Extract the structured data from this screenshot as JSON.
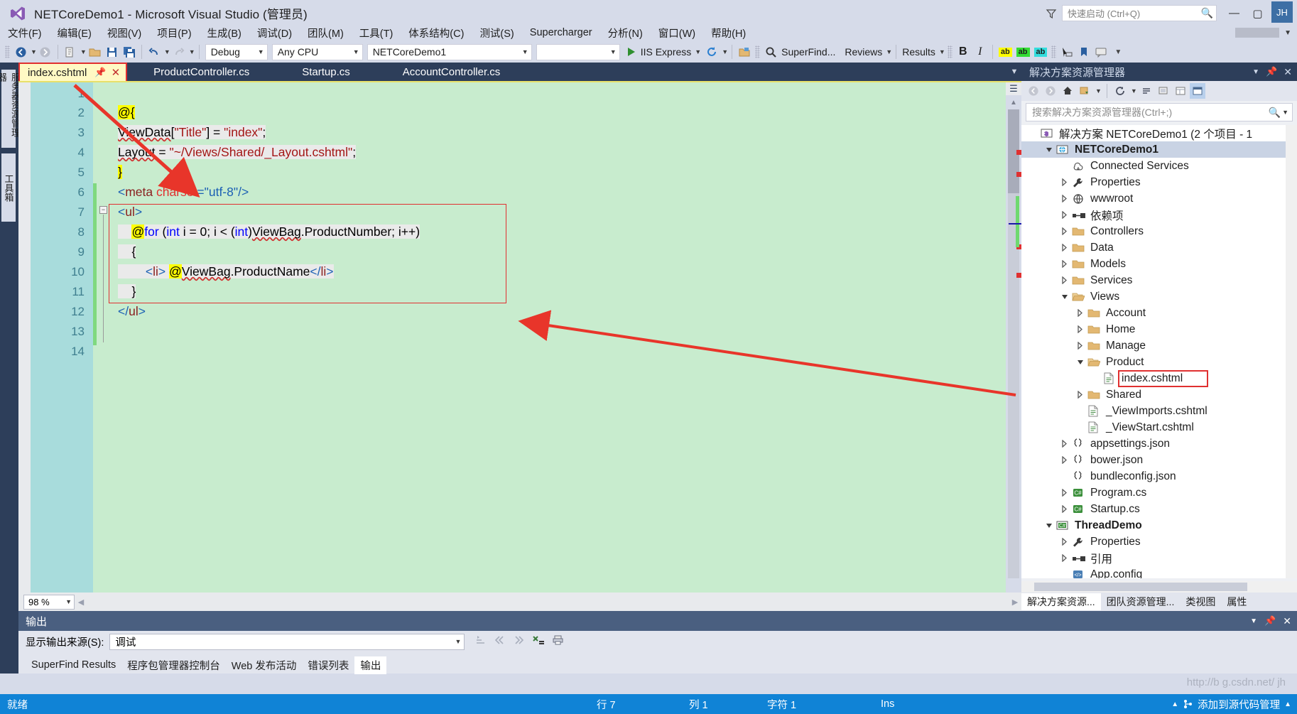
{
  "window": {
    "title": "NETCoreDemo1 - Microsoft Visual Studio (管理员)",
    "logo_icon": "visual-studio-logo-icon",
    "minimize_label": "—",
    "maximize_label": "▢",
    "close_label": "✕",
    "feedback_icon": "feedback-funnel-icon",
    "avatar_initials": "JH"
  },
  "quick_launch": {
    "placeholder": "快速启动 (Ctrl+Q)",
    "icon": "search-icon"
  },
  "menubar": {
    "items": [
      {
        "label": "文件(F)"
      },
      {
        "label": "编辑(E)"
      },
      {
        "label": "视图(V)"
      },
      {
        "label": "项目(P)"
      },
      {
        "label": "生成(B)"
      },
      {
        "label": "调试(D)"
      },
      {
        "label": "团队(M)"
      },
      {
        "label": "工具(T)"
      },
      {
        "label": "体系结构(C)"
      },
      {
        "label": "测试(S)"
      },
      {
        "label": "Supercharger"
      },
      {
        "label": "分析(N)"
      },
      {
        "label": "窗口(W)"
      },
      {
        "label": "帮助(H)"
      }
    ]
  },
  "toolbar": {
    "nav_back_icon": "navigate-back-icon",
    "nav_forward_icon": "navigate-forward-icon",
    "new_item_icon": "new-item-icon",
    "open_file_icon": "open-file-icon",
    "save_icon": "save-icon",
    "save_all_icon": "save-all-icon",
    "undo_icon": "undo-icon",
    "redo_icon": "redo-icon",
    "config_value": "Debug",
    "platform_value": "Any CPU",
    "startup_project_value": "NETCoreDemo1",
    "blank_combo_value": "",
    "run_label": "IIS Express",
    "run_icon": "play-icon",
    "refresh_icon": "refresh-icon",
    "folder_icon": "folder-icon",
    "superfind_label": "SuperFind...",
    "superfind_icon": "magnifier-icon",
    "reviews_label": "Reviews",
    "results_label": "Results",
    "bold_label": "B",
    "italic_label": "I",
    "highlight_yellow_label": "ab",
    "highlight_green_label": "ab",
    "highlight_cyan_label": "ab",
    "highlight_yellow_color": "#ffff00",
    "highlight_green_color": "#33dd33",
    "highlight_cyan_color": "#33dddd",
    "pointer_icon": "pointer-icon",
    "bookmark_icon": "bookmark-icon",
    "comment_icon": "comment-icon",
    "overflow_icon": "toolbar-overflow-icon"
  },
  "left_rail": {
    "items": [
      {
        "label": "服务器资源管理器"
      },
      {
        "label": "工具箱"
      }
    ]
  },
  "editor": {
    "tabs": [
      {
        "label": "index.cshtml",
        "active": true,
        "pin_icon": "pin-icon",
        "close_icon": "close-icon"
      },
      {
        "label": "ProductController.cs",
        "active": false
      },
      {
        "label": "Startup.cs",
        "active": false
      },
      {
        "label": "AccountController.cs",
        "active": false
      }
    ],
    "overflow_icon": "chevron-down-icon",
    "zoom_level": "98 %",
    "lines": [
      {
        "n": "1",
        "text": ""
      },
      {
        "n": "2",
        "text": "@{"
      },
      {
        "n": "3",
        "text": "    ViewData[\"Title\"] = \"index\";"
      },
      {
        "n": "4",
        "text": "    Layout = \"~/Views/Shared/_Layout.cshtml\";"
      },
      {
        "n": "5",
        "text": "}"
      },
      {
        "n": "6",
        "text": "<meta charset=\"utf-8\"/>"
      },
      {
        "n": "7",
        "text": "<ul>"
      },
      {
        "n": "8",
        "text": "    @for (int i = 0; i < (int)ViewBag.ProductNumber; i++)"
      },
      {
        "n": "9",
        "text": "    {"
      },
      {
        "n": "10",
        "text": "        <li> @ViewBag.ProductName</li>"
      },
      {
        "n": "11",
        "text": "    }"
      },
      {
        "n": "12",
        "text": "</ul>"
      },
      {
        "n": "13",
        "text": ""
      },
      {
        "n": "14",
        "text": ""
      }
    ]
  },
  "solution_explorer": {
    "title": "解决方案资源管理器",
    "pin_icon": "pin-icon",
    "close_icon": "close-icon",
    "chevron_icon": "chevron-down-icon",
    "toolbar_icons": [
      "back-icon",
      "forward-icon",
      "home-icon",
      "switch-views-icon",
      "refresh-icon",
      "collapse-all-icon",
      "show-all-files-icon",
      "properties-icon",
      "preview-selected-icon"
    ],
    "search_placeholder": "搜索解决方案资源管理器(Ctrl+;)",
    "search_icon": "search-icon",
    "tree": [
      {
        "label": "解决方案 NETCoreDemo1 (2 个项目 - 1",
        "depth": 0,
        "icon": "solution-icon",
        "twisty": "none",
        "bold": false
      },
      {
        "label": "NETCoreDemo1",
        "depth": 1,
        "icon": "web-project-icon",
        "twisty": "expanded",
        "bold": true,
        "selected": true
      },
      {
        "label": "Connected Services",
        "depth": 2,
        "icon": "connected-services-icon",
        "twisty": "none"
      },
      {
        "label": "Properties",
        "depth": 2,
        "icon": "wrench-icon",
        "twisty": "collapsed"
      },
      {
        "label": "wwwroot",
        "depth": 2,
        "icon": "globe-icon",
        "twisty": "collapsed"
      },
      {
        "label": "依赖项",
        "depth": 2,
        "icon": "dependencies-icon",
        "twisty": "collapsed"
      },
      {
        "label": "Controllers",
        "depth": 2,
        "icon": "folder-icon",
        "twisty": "collapsed"
      },
      {
        "label": "Data",
        "depth": 2,
        "icon": "folder-icon",
        "twisty": "collapsed"
      },
      {
        "label": "Models",
        "depth": 2,
        "icon": "folder-icon",
        "twisty": "collapsed"
      },
      {
        "label": "Services",
        "depth": 2,
        "icon": "folder-icon",
        "twisty": "collapsed"
      },
      {
        "label": "Views",
        "depth": 2,
        "icon": "folder-open-icon",
        "twisty": "expanded"
      },
      {
        "label": "Account",
        "depth": 3,
        "icon": "folder-icon",
        "twisty": "collapsed"
      },
      {
        "label": "Home",
        "depth": 3,
        "icon": "folder-icon",
        "twisty": "collapsed"
      },
      {
        "label": "Manage",
        "depth": 3,
        "icon": "folder-icon",
        "twisty": "collapsed"
      },
      {
        "label": "Product",
        "depth": 3,
        "icon": "folder-open-icon",
        "twisty": "expanded"
      },
      {
        "label": "index.cshtml",
        "depth": 4,
        "icon": "cshtml-file-icon",
        "twisty": "none",
        "highlight": true
      },
      {
        "label": "Shared",
        "depth": 3,
        "icon": "folder-icon",
        "twisty": "collapsed"
      },
      {
        "label": "_ViewImports.cshtml",
        "depth": 3,
        "icon": "cshtml-file-icon",
        "twisty": "none"
      },
      {
        "label": "_ViewStart.cshtml",
        "depth": 3,
        "icon": "cshtml-file-icon",
        "twisty": "none"
      },
      {
        "label": "appsettings.json",
        "depth": 2,
        "icon": "json-file-icon",
        "twisty": "collapsed"
      },
      {
        "label": "bower.json",
        "depth": 2,
        "icon": "json-file-icon",
        "twisty": "collapsed"
      },
      {
        "label": "bundleconfig.json",
        "depth": 2,
        "icon": "json-file-icon",
        "twisty": "none"
      },
      {
        "label": "Program.cs",
        "depth": 2,
        "icon": "csharp-file-icon",
        "twisty": "collapsed"
      },
      {
        "label": "Startup.cs",
        "depth": 2,
        "icon": "csharp-file-icon",
        "twisty": "collapsed"
      },
      {
        "label": "ThreadDemo",
        "depth": 1,
        "icon": "csharp-project-icon",
        "twisty": "expanded",
        "bold": true
      },
      {
        "label": "Properties",
        "depth": 2,
        "icon": "wrench-icon",
        "twisty": "collapsed"
      },
      {
        "label": "引用",
        "depth": 2,
        "icon": "dependencies-icon",
        "twisty": "collapsed"
      },
      {
        "label": "App.config",
        "depth": 2,
        "icon": "config-file-icon",
        "twisty": "none"
      }
    ],
    "bottom_tabs": [
      {
        "label": "解决方案资源...",
        "active": true
      },
      {
        "label": "团队资源管理...",
        "active": false
      },
      {
        "label": "类视图",
        "active": false
      },
      {
        "label": "属性",
        "active": false
      }
    ]
  },
  "output_panel": {
    "title": "输出",
    "chevron_icon": "chevron-down-icon",
    "pin_icon": "pin-icon",
    "close_icon": "close-icon",
    "source_label": "显示输出来源(S):",
    "source_value": "调试",
    "tool_icons": [
      "find-message-icon",
      "clear-all-icon",
      "toggle-wordwrap-icon",
      "clear-output-icon",
      "print-icon"
    ],
    "tabs": [
      {
        "label": "SuperFind Results",
        "active": false
      },
      {
        "label": "程序包管理器控制台",
        "active": false
      },
      {
        "label": "Web 发布活动",
        "active": false
      },
      {
        "label": "错误列表",
        "active": false
      },
      {
        "label": "输出",
        "active": true
      }
    ]
  },
  "statusbar": {
    "ready": "就绪",
    "line_label": "行 7",
    "col_label": "列 1",
    "char_label": "字符 1",
    "ins_label": "Ins",
    "source_control": "添加到源代码管理",
    "source_control_icon": "source-control-icon",
    "up_icon": "chevron-up-icon",
    "watermark": "http://b   g.csdn.net/ jh"
  },
  "colors": {
    "title_bar": "#d6dbe9",
    "accent_blue": "#1083d6",
    "editor_bg": "#c8ecce",
    "gutter_bg": "#a8dcdc",
    "tab_active_bg": "#fff9c4",
    "annotation_red": "#e03030",
    "panel_dark": "#2d3e5a"
  }
}
